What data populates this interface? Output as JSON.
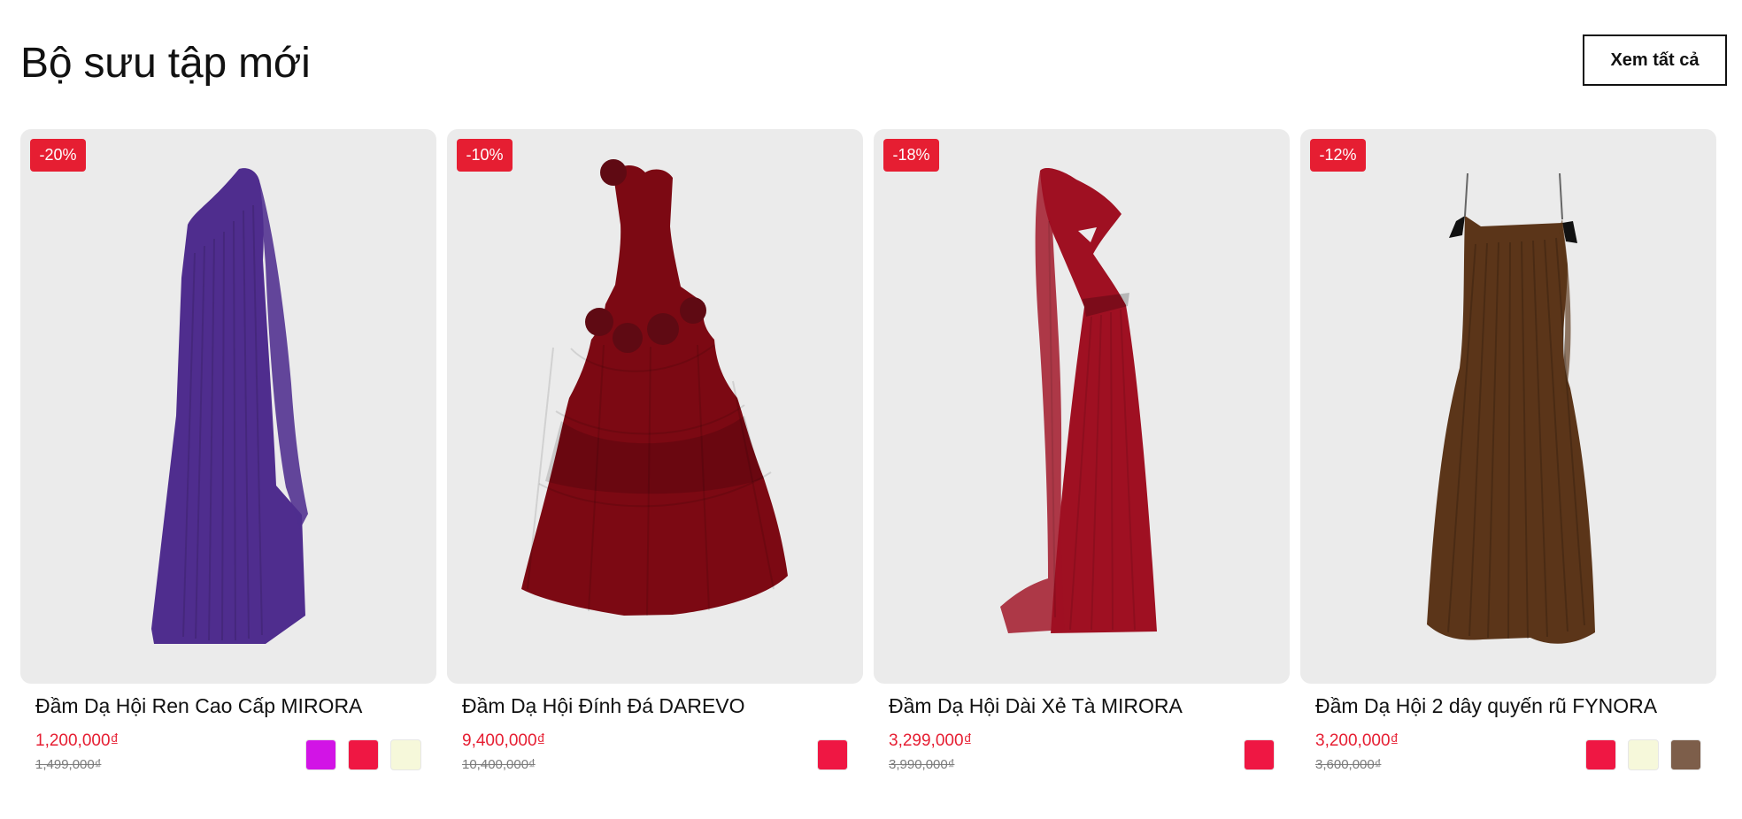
{
  "section": {
    "title": "Bộ sưu tập mới",
    "view_all_label": "Xem tất cả"
  },
  "products": [
    {
      "discount": "-20%",
      "name": "Đầm Dạ Hội Ren Cao Cấp MIRORA",
      "price": "1,200,000₫",
      "original_price": "1,499,000₫",
      "image_semantic": "purple-one-shoulder-gown",
      "dress_color": "#4f2d8e",
      "swatches": [
        "#d214e6",
        "#ef1743",
        "#f6f8da"
      ]
    },
    {
      "discount": "-10%",
      "name": "Đầm Dạ Hội Đính Đá DAREVO",
      "price": "9,400,000₫",
      "original_price": "10,400,000₫",
      "image_semantic": "burgundy-ruffled-ballgown",
      "dress_color": "#7c0913",
      "swatches": [
        "#ef1743"
      ]
    },
    {
      "discount": "-18%",
      "name": "Đầm Dạ Hội Dài Xẻ Tà MIRORA",
      "price": "3,299,000₫",
      "original_price": "3,990,000₫",
      "image_semantic": "red-one-shoulder-cape-gown",
      "dress_color": "#9f1022",
      "swatches": [
        "#ef1743"
      ]
    },
    {
      "discount": "-12%",
      "name": "Đầm Dạ Hội 2 dây quyến rũ FYNORA",
      "price": "3,200,000₫",
      "original_price": "3,600,000₫",
      "image_semantic": "brown-pleated-slip-gown",
      "dress_color": "#5b3519",
      "swatches": [
        "#ef1743",
        "#f6f8da",
        "#7d5e4a"
      ]
    }
  ]
}
